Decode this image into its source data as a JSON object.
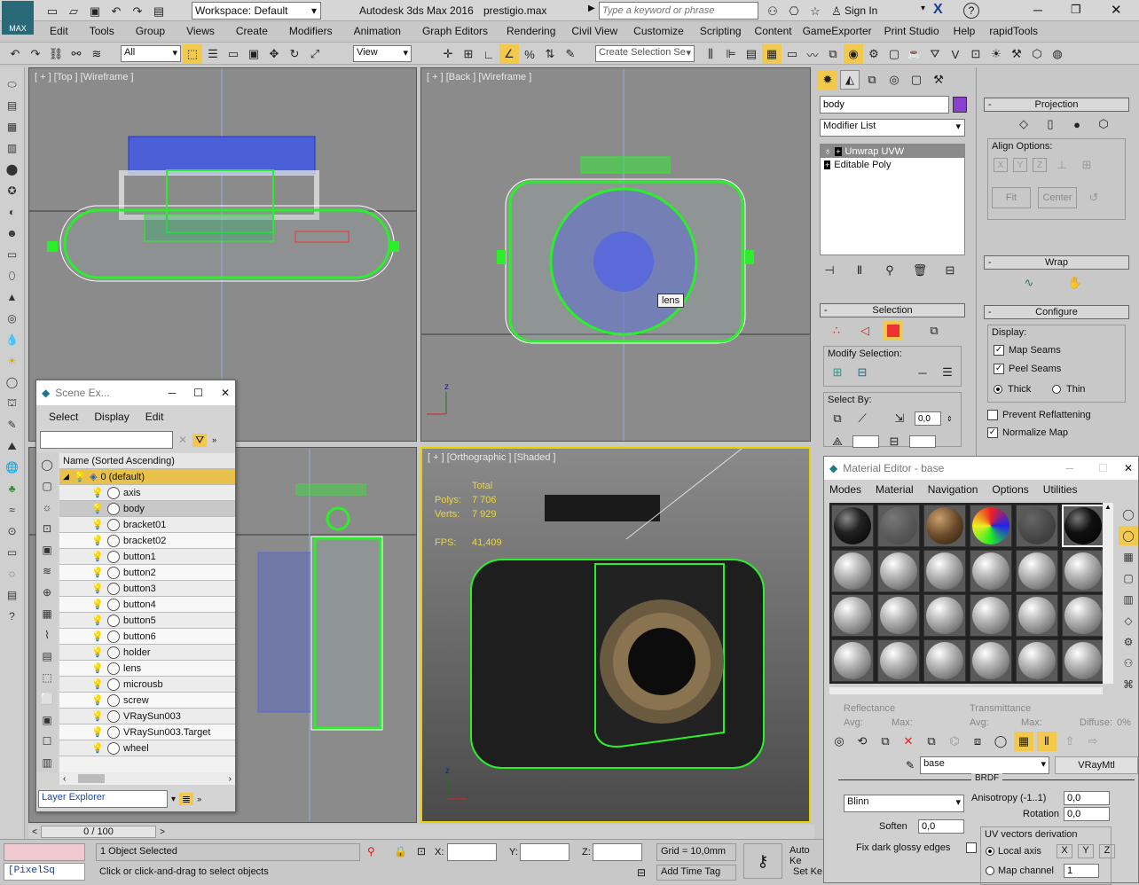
{
  "title_bar": {
    "workspace": "Workspace: Default",
    "app_title": "Autodesk 3ds Max 2016",
    "file_name": "prestigio.max",
    "search_placeholder": "Type a keyword or phrase",
    "sign_in": "Sign In"
  },
  "menu": [
    "Edit",
    "Tools",
    "Group",
    "Views",
    "Create",
    "Modifiers",
    "Animation",
    "Graph Editors",
    "Rendering",
    "Civil View",
    "Customize",
    "Scripting",
    "Content",
    "GameExporter",
    "Print Studio",
    "Help",
    "rapidTools"
  ],
  "main_toolbar": {
    "filter_value": "All",
    "ref_coord": "View",
    "selection_set_placeholder": "Create Selection Se"
  },
  "viewports": {
    "top": "[ + ] [Top ] [Wireframe ]",
    "back": "[ + ] [Back ] [Wireframe ]",
    "left": "",
    "ortho": "[ + ] [Orthographic ] [Shaded ]",
    "lens_tooltip": "lens"
  },
  "stats": {
    "total_label": "Total",
    "polys_label": "Polys:",
    "polys_value": "7 706",
    "verts_label": "Verts:",
    "verts_value": "7 929",
    "fps_label": "FPS:",
    "fps_value": "41,409"
  },
  "scene_explorer": {
    "title": "Scene Ex...",
    "menu": [
      "Select",
      "Display",
      "Edit"
    ],
    "column_header": "Name (Sorted Ascending)",
    "root": "0 (default)",
    "items": [
      "axis",
      "body",
      "bracket01",
      "bracket02",
      "button1",
      "button2",
      "button3",
      "button4",
      "button5",
      "button6",
      "holder",
      "lens",
      "microusb",
      "screw",
      "VRaySun003",
      "VRaySun003.Target",
      "wheel"
    ],
    "selected": "body",
    "footer": "Layer Explorer"
  },
  "command_panel": {
    "object_name": "body",
    "object_color": "#8b3fd1",
    "modifier_list": "Modifier List",
    "stack": [
      "Unwrap UVW",
      "Editable Poly"
    ],
    "selection_rollout": "Selection",
    "modify_selection": "Modify Selection:",
    "select_by": "Select By:",
    "select_by_value": "0,0"
  },
  "unwrap_panel": {
    "projection": "Projection",
    "align_options": "Align Options:",
    "align_axes": [
      "X",
      "Y",
      "Z"
    ],
    "fit": "Fit",
    "center": "Center",
    "wrap": "Wrap",
    "configure": "Configure",
    "display": "Display:",
    "map_seams": "Map Seams",
    "peel_seams": "Peel Seams",
    "thick": "Thick",
    "thin": "Thin",
    "prevent_reflattening": "Prevent Reflattening",
    "normalize_map": "Normalize Map"
  },
  "material_editor": {
    "title": "Material Editor - base",
    "menu": [
      "Modes",
      "Material",
      "Navigation",
      "Options",
      "Utilities"
    ],
    "reflectance": "Reflectance",
    "transmittance": "Transmittance",
    "avg": "Avg:",
    "max": "Max:",
    "diffuse": "Diffuse:",
    "diffuse_value": "0%",
    "material_name": "base",
    "material_type": "VRayMtl",
    "brdf": "BRDF",
    "brdf_type": "Blinn",
    "anisotropy_label": "Anisotropy (-1..1)",
    "anisotropy_value": "0,0",
    "rotation_label": "Rotation",
    "rotation_value": "0,0",
    "soften_label": "Soften",
    "soften_value": "0,0",
    "fix_dark": "Fix dark glossy edges",
    "uv_vectors": "UV vectors derivation",
    "local_axis": "Local axis",
    "map_channel": "Map channel",
    "map_channel_value": "1",
    "axes": [
      "X",
      "Y",
      "Z"
    ]
  },
  "timeline": {
    "frame": "0 / 100"
  },
  "status": {
    "objects_selected": "1 Object Selected",
    "prompt": "Click or click-and-drag to select objects",
    "x_label": "X:",
    "y_label": "Y:",
    "z_label": "Z:",
    "grid": "Grid = 10,0mm",
    "add_time_tag": "Add Time Tag",
    "auto_key": "Auto Ke",
    "set_key": "Set Ke",
    "maxscript": "[PixelSq"
  },
  "icon_names": [
    "max-logo-icon",
    "new-icon",
    "open-icon",
    "save-icon",
    "undo-icon",
    "redo-icon",
    "binoculars-icon",
    "star-icon",
    "user-icon",
    "help-icon"
  ]
}
